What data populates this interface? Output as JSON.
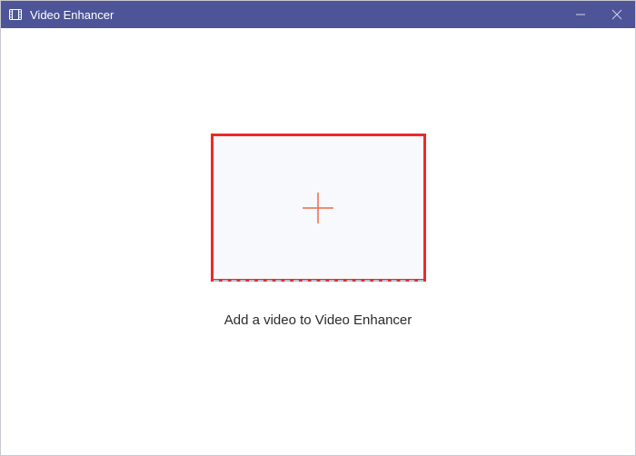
{
  "window": {
    "title": "Video Enhancer"
  },
  "main": {
    "caption": "Add a video to Video Enhancer"
  },
  "colors": {
    "titlebar": "#4d5598",
    "highlight_border": "#ec2a2a",
    "plus_stroke": "#ef6a4a",
    "dropzone_bg": "#f7f9fc"
  }
}
